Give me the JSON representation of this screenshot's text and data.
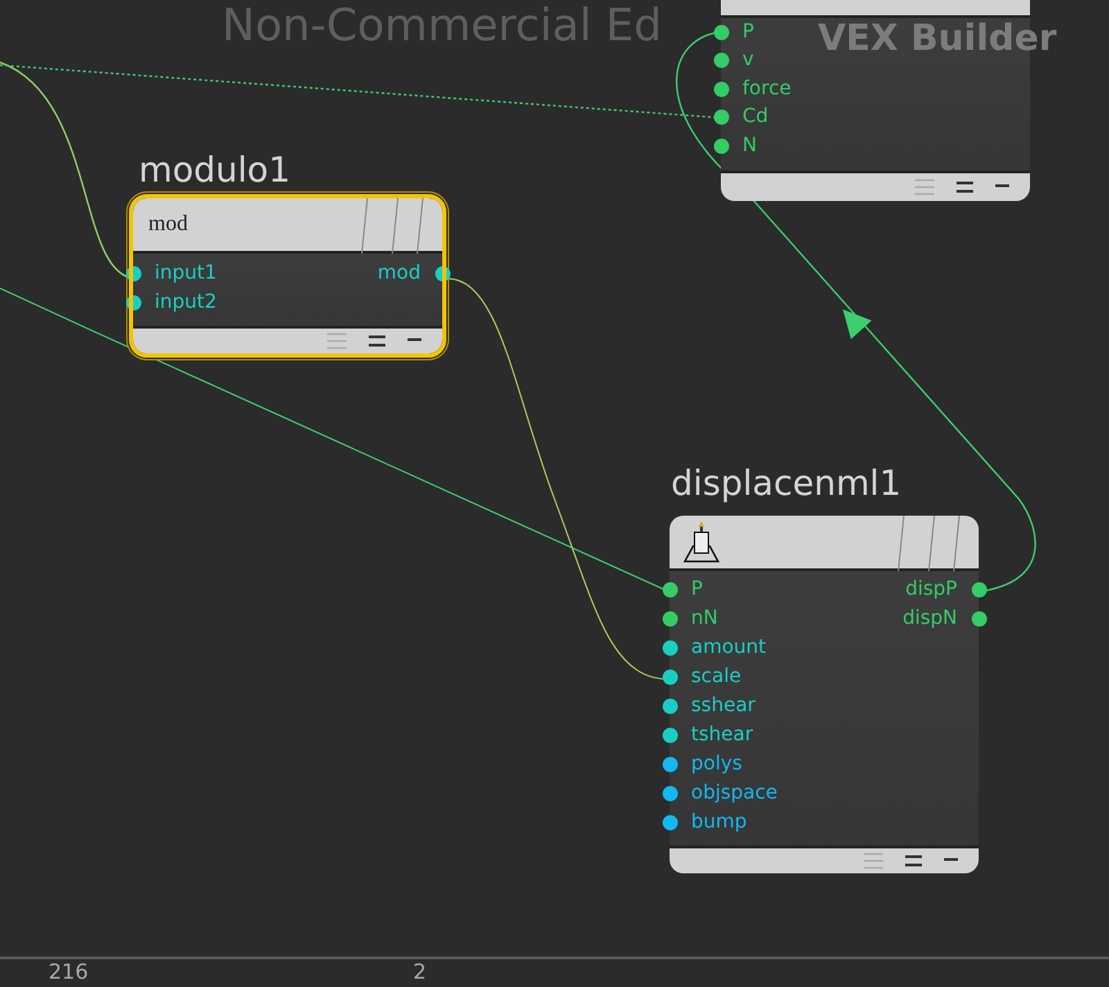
{
  "overlay": {
    "edition": "Non-Commercial Ed",
    "context": "VEX Builder"
  },
  "nodes": [
    {
      "selected": false,
      "header": {
        "kind": "none"
      },
      "inputs": [
        {
          "label": "P",
          "color": "#33cc66"
        },
        {
          "label": "v",
          "color": "#33cc66"
        },
        {
          "label": "force",
          "color": "#33cc66"
        },
        {
          "label": "Cd",
          "color": "#33cc66"
        },
        {
          "label": "N",
          "color": "#33cc66"
        }
      ]
    },
    {
      "title": "modulo1",
      "selected": true,
      "header": {
        "kind": "text",
        "label": "mod"
      },
      "inputs": [
        {
          "label": "input1",
          "color": "#19cfc4"
        },
        {
          "label": "input2",
          "color": "#19cfc4"
        }
      ],
      "outputs": [
        {
          "label": "mod",
          "color": "#19cfc4"
        }
      ]
    },
    {
      "title": "displacenml1",
      "selected": false,
      "header": {
        "kind": "icon"
      },
      "inputs": [
        {
          "label": "P",
          "color": "#33cc66"
        },
        {
          "label": "nN",
          "color": "#33cc66"
        },
        {
          "label": "amount",
          "color": "#19cfc4"
        },
        {
          "label": "scale",
          "color": "#19cfc4"
        },
        {
          "label": "sshear",
          "color": "#19cfc4"
        },
        {
          "label": "tshear",
          "color": "#19cfc4"
        },
        {
          "label": "polys",
          "color": "#12b8f0"
        },
        {
          "label": "objspace",
          "color": "#12b8f0"
        },
        {
          "label": "bump",
          "color": "#12b8f0"
        }
      ],
      "outputs": [
        {
          "label": "dispP",
          "color": "#33cc66"
        },
        {
          "label": "dispN",
          "color": "#33cc66"
        }
      ]
    }
  ],
  "status": [
    "216",
    "2"
  ]
}
